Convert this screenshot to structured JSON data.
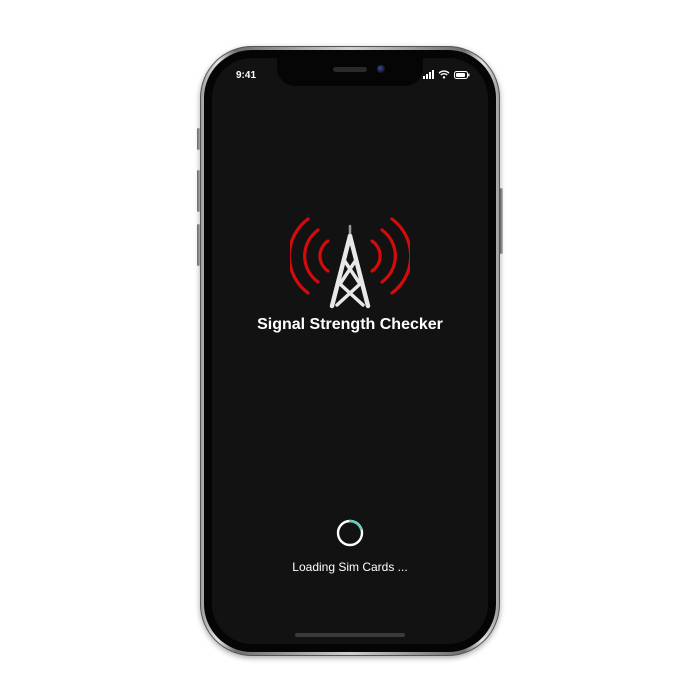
{
  "status_bar": {
    "time": "9:41",
    "icons": [
      "cellular-signal-icon",
      "wifi-icon",
      "battery-icon"
    ]
  },
  "app": {
    "logo_icon": "signal-tower-icon",
    "title": "Signal Strength Checker",
    "loading_text": "Loading Sim Cards ...",
    "spinner_icon": "loading-spinner-icon"
  },
  "colors": {
    "background": "#121212",
    "wave_red": "#d30b0b",
    "tower_white": "#e8e8e8",
    "spinner_accent": "#5fd3c3"
  }
}
